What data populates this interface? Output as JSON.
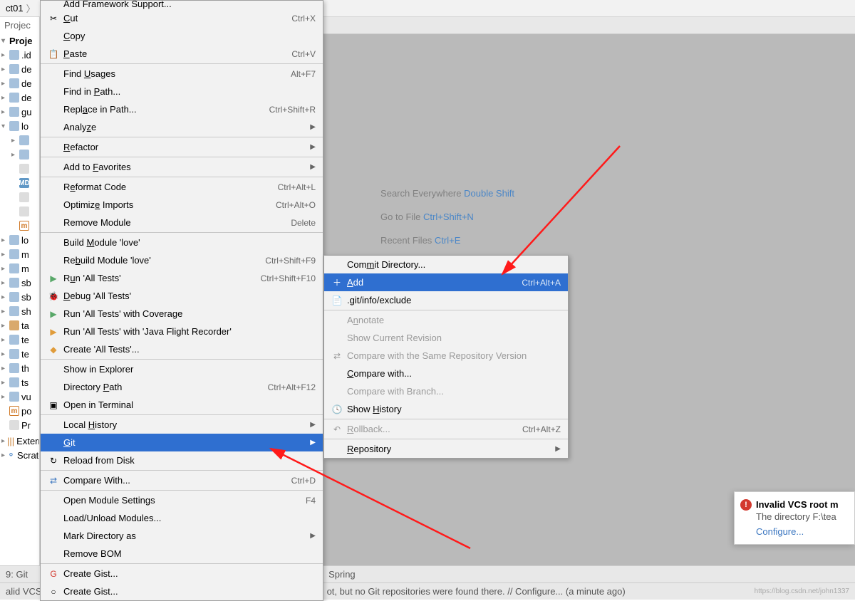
{
  "breadcrumb": {
    "item": "ct01"
  },
  "sidebar": {
    "header": "Projec",
    "rootLabel": "Proje",
    "nodes": [
      {
        "label": ".id",
        "icon": "fold"
      },
      {
        "label": "de",
        "icon": "fold"
      },
      {
        "label": "de",
        "icon": "fold"
      },
      {
        "label": "de",
        "icon": "fold"
      },
      {
        "label": "gu",
        "icon": "fold"
      },
      {
        "label": "lo",
        "icon": "fold",
        "expanded": true
      },
      {
        "label": "",
        "icon": "fold",
        "indent": 1
      },
      {
        "label": "",
        "icon": "fold",
        "indent": 1
      },
      {
        "label": "",
        "icon": "file",
        "indent": 1
      },
      {
        "label": "",
        "icon": "md",
        "indent": 1
      },
      {
        "label": "",
        "icon": "file",
        "indent": 1
      },
      {
        "label": "",
        "icon": "file",
        "indent": 1
      },
      {
        "label": "",
        "icon": "m",
        "indent": 1
      },
      {
        "label": "lo",
        "icon": "fold"
      },
      {
        "label": "m",
        "icon": "fold"
      },
      {
        "label": "m",
        "icon": "fold"
      },
      {
        "label": "sb",
        "icon": "fold"
      },
      {
        "label": "sb",
        "icon": "fold"
      },
      {
        "label": "sh",
        "icon": "fold"
      },
      {
        "label": "ta",
        "icon": "fold-o"
      },
      {
        "label": "te",
        "icon": "fold"
      },
      {
        "label": "te",
        "icon": "fold"
      },
      {
        "label": "th",
        "icon": "fold"
      },
      {
        "label": "ts",
        "icon": "fold"
      },
      {
        "label": "vu",
        "icon": "fold"
      },
      {
        "label": "po",
        "icon": "m"
      },
      {
        "label": "Pr",
        "icon": "file"
      }
    ],
    "extern": "Extern",
    "scratch": "Scratc"
  },
  "welcome": {
    "l1a": "Search Everywhere ",
    "l1b": "Double Shift",
    "l2a": "Go to File ",
    "l2b": "Ctrl+Shift+N",
    "l3a": "Recent Files ",
    "l3b": "Ctrl+E"
  },
  "menu": [
    {
      "label": "Add Framework Support...",
      "trunc": true
    },
    {
      "label": "Cut",
      "short": "Ctrl+X",
      "icon": "✂",
      "u": 0
    },
    {
      "label": "Copy",
      "u": 0
    },
    {
      "label": "Paste",
      "short": "Ctrl+V",
      "icon": "📋",
      "u": 0
    },
    {
      "sep": true
    },
    {
      "label": "Find Usages",
      "short": "Alt+F7",
      "u": 5
    },
    {
      "label": "Find in Path...",
      "u": 8
    },
    {
      "label": "Replace in Path...",
      "short": "Ctrl+Shift+R",
      "u": 4
    },
    {
      "label": "Analyze",
      "sub": true,
      "u": 5
    },
    {
      "sep": true
    },
    {
      "label": "Refactor",
      "sub": true,
      "u": 0
    },
    {
      "sep": true
    },
    {
      "label": "Add to Favorites",
      "sub": true,
      "u": 7
    },
    {
      "sep": true
    },
    {
      "label": "Reformat Code",
      "short": "Ctrl+Alt+L",
      "u": 1
    },
    {
      "label": "Optimize Imports",
      "short": "Ctrl+Alt+O",
      "u": 7
    },
    {
      "label": "Remove Module",
      "short": "Delete"
    },
    {
      "sep": true
    },
    {
      "label": "Build Module 'love'",
      "u": 6
    },
    {
      "label": "Rebuild Module 'love'",
      "short": "Ctrl+Shift+F9",
      "u": 2
    },
    {
      "label": "Run 'All Tests'",
      "short": "Ctrl+Shift+F10",
      "icon": "▶",
      "iconColor": "#59a869",
      "u": 1
    },
    {
      "label": "Debug 'All Tests'",
      "icon": "🐞",
      "iconColor": "#499c54",
      "u": 0
    },
    {
      "label": "Run 'All Tests' with Coverage",
      "icon": "▶",
      "iconColor": "#59a869"
    },
    {
      "label": "Run 'All Tests' with 'Java Flight Recorder'",
      "icon": "▶",
      "iconColor": "#e09c3b"
    },
    {
      "label": "Create 'All Tests'...",
      "icon": "◆",
      "iconColor": "#e09c3b"
    },
    {
      "sep": true
    },
    {
      "label": "Show in Explorer"
    },
    {
      "label": "Directory Path",
      "short": "Ctrl+Alt+F12",
      "u": 10
    },
    {
      "label": "Open in Terminal",
      "icon": "▣"
    },
    {
      "sep": true
    },
    {
      "label": "Local History",
      "sub": true,
      "u": 6
    },
    {
      "label": "Git",
      "sub": true,
      "selected": true,
      "u": 0
    },
    {
      "label": "Reload from Disk",
      "icon": "↻"
    },
    {
      "sep": true
    },
    {
      "label": "Compare With...",
      "short": "Ctrl+D",
      "icon": "⇄",
      "iconColor": "#3874bf"
    },
    {
      "sep": true
    },
    {
      "label": "Open Module Settings",
      "short": "F4"
    },
    {
      "label": "Load/Unload Modules..."
    },
    {
      "label": "Mark Directory as",
      "sub": true
    },
    {
      "label": "Remove BOM"
    },
    {
      "sep": true
    },
    {
      "label": "Create Gist...",
      "icon": "G",
      "iconColor": "#d33a2f"
    },
    {
      "label": "Create Gist...",
      "icon": "○"
    }
  ],
  "submenu": [
    {
      "label": "Commit Directory...",
      "u": 3
    },
    {
      "label": "Add",
      "short": "Ctrl+Alt+A",
      "selected": true,
      "icon": "＋",
      "u": 0
    },
    {
      "label": ".git/info/exclude",
      "icon": "📄"
    },
    {
      "sep": true
    },
    {
      "label": "Annotate",
      "disabled": true,
      "u": 1
    },
    {
      "label": "Show Current Revision",
      "disabled": true
    },
    {
      "label": "Compare with the Same Repository Version",
      "disabled": true,
      "icon": "⇄",
      "u": 40
    },
    {
      "label": "Compare with...",
      "u": 0
    },
    {
      "label": "Compare with Branch...",
      "disabled": true
    },
    {
      "label": "Show History",
      "icon": "🕓",
      "u": 5
    },
    {
      "sep": true
    },
    {
      "label": "Rollback...",
      "short": "Ctrl+Alt+Z",
      "disabled": true,
      "icon": "↶",
      "u": 0
    },
    {
      "sep": true
    },
    {
      "label": "Repository",
      "sub": true,
      "u": 0
    }
  ],
  "notif": {
    "title": "Invalid VCS root m",
    "body": "The directory F:\\tea",
    "link": "Configure..."
  },
  "status": {
    "left": "9: Git",
    "left2": "alid VCS",
    "spring": "Spring",
    "msg": "ot, but no Git repositories were found there. // Configure... (a minute ago)",
    "credit": "https://blog.csdn.net/john1337"
  }
}
